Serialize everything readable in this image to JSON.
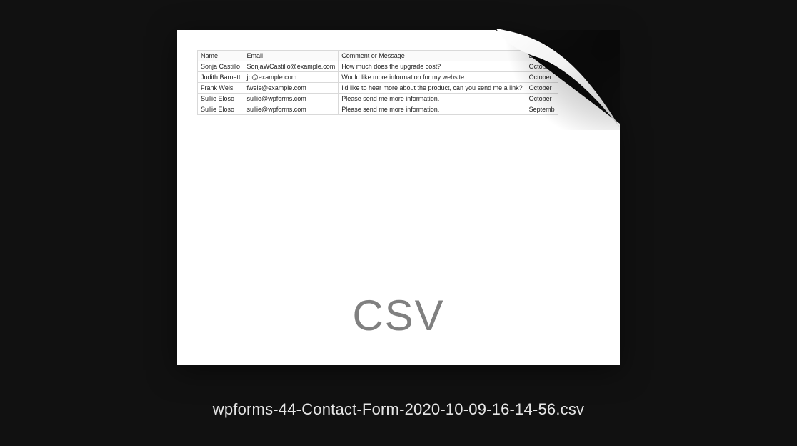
{
  "file_label": "CSV",
  "filename": "wpforms-44-Contact-Form-2020-10-09-16-14-56.csv",
  "table": {
    "headers": [
      "Name",
      "Email",
      "Comment or Message",
      "Entry"
    ],
    "rows": [
      {
        "name": "Sonja Castillo",
        "email": "SonjaWCastillo@example.com",
        "comment": "How much does the upgrade cost?",
        "entry": "October"
      },
      {
        "name": "Judith Barnett",
        "email": "jb@example.com",
        "comment": "Would like more information for my website",
        "entry": "October"
      },
      {
        "name": "Frank Weis",
        "email": "fweis@example.com",
        "comment": "I'd like to hear more about the product, can you send me a link?",
        "entry": "October"
      },
      {
        "name": "Sullie Eloso",
        "email": "sullie@wpforms.com",
        "comment": "Please send me more information.",
        "entry": "October"
      },
      {
        "name": "Sullie Eloso",
        "email": "sullie@wpforms.com",
        "comment": "Please send me more information.",
        "entry": "Septemb"
      }
    ]
  }
}
